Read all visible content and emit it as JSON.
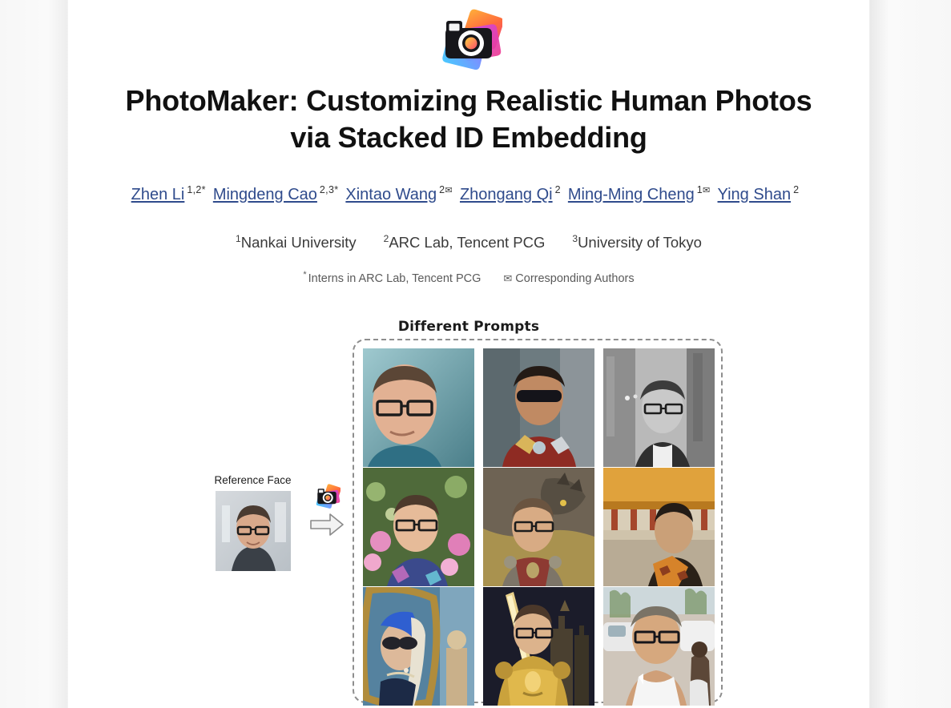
{
  "page": {
    "title": "PhotoMaker: Customizing Realistic Human Photos via Stacked ID Embedding",
    "title_line1": "PhotoMaker: Customizing Realistic Human Photos",
    "title_line2": "via Stacked ID Embedding",
    "logo_name": "photomaker-logo"
  },
  "authors": [
    {
      "name": "Zhen Li",
      "marks": "1,2*"
    },
    {
      "name": "Mingdeng Cao",
      "marks": "2,3*"
    },
    {
      "name": "Xintao Wang",
      "marks": "2",
      "envelope": true
    },
    {
      "name": "Zhongang Qi",
      "marks": "2"
    },
    {
      "name": "Ming-Ming Cheng",
      "marks": "1",
      "envelope": true
    },
    {
      "name": "Ying Shan",
      "marks": "2"
    }
  ],
  "affiliations": [
    {
      "sup": "1",
      "name": "Nankai University"
    },
    {
      "sup": "2",
      "name": "ARC Lab, Tencent PCG"
    },
    {
      "sup": "3",
      "name": "University of Tokyo"
    }
  ],
  "notes": {
    "interns": "Interns in ARC Lab, Tencent PCG",
    "interns_mark": "*",
    "corresponding": "Corresponding Authors",
    "corresponding_icon": "envelope-icon"
  },
  "teaser": {
    "prompts_label": "Different Prompts",
    "reference_label": "Reference Face",
    "reference_image_alt": "reference-face-photo",
    "arrow_icon": "right-arrow-icon",
    "inline_logo": "photomaker-logo-small",
    "grid": [
      {
        "id": "r1c1",
        "alt": "portrait-with-glasses-teal-background"
      },
      {
        "id": "r1c2",
        "alt": "ironman-armor-sunglasses-portrait"
      },
      {
        "id": "r1c3",
        "alt": "black-and-white-city-street-portrait"
      },
      {
        "id": "r2c1",
        "alt": "flower-garden-colorful-shirt-portrait"
      },
      {
        "id": "r2c2",
        "alt": "knight-with-dragon-portrait"
      },
      {
        "id": "r2c3",
        "alt": "forbidden-city-emperor-robe-portrait"
      },
      {
        "id": "r3c1",
        "alt": "girl-with-pearl-earring-painting-sunglasses"
      },
      {
        "id": "r3c2",
        "alt": "golden-armor-knight-sword-castle"
      },
      {
        "id": "r3c3",
        "alt": "white-tank-top-street-portrait"
      }
    ]
  },
  "colors": {
    "link": "#2f4b8c",
    "title": "#111111",
    "affiliation": "#3b3b3b",
    "note": "#5a5a5a",
    "dashed_border": "#8e8e8e",
    "page_background": "#ffffff",
    "outer_background": "#f7f7f7",
    "logo_orange": "#ff8a3d",
    "logo_pink": "#ef3b8f",
    "logo_purple": "#9b4dff",
    "logo_blue": "#4aa8ff"
  }
}
